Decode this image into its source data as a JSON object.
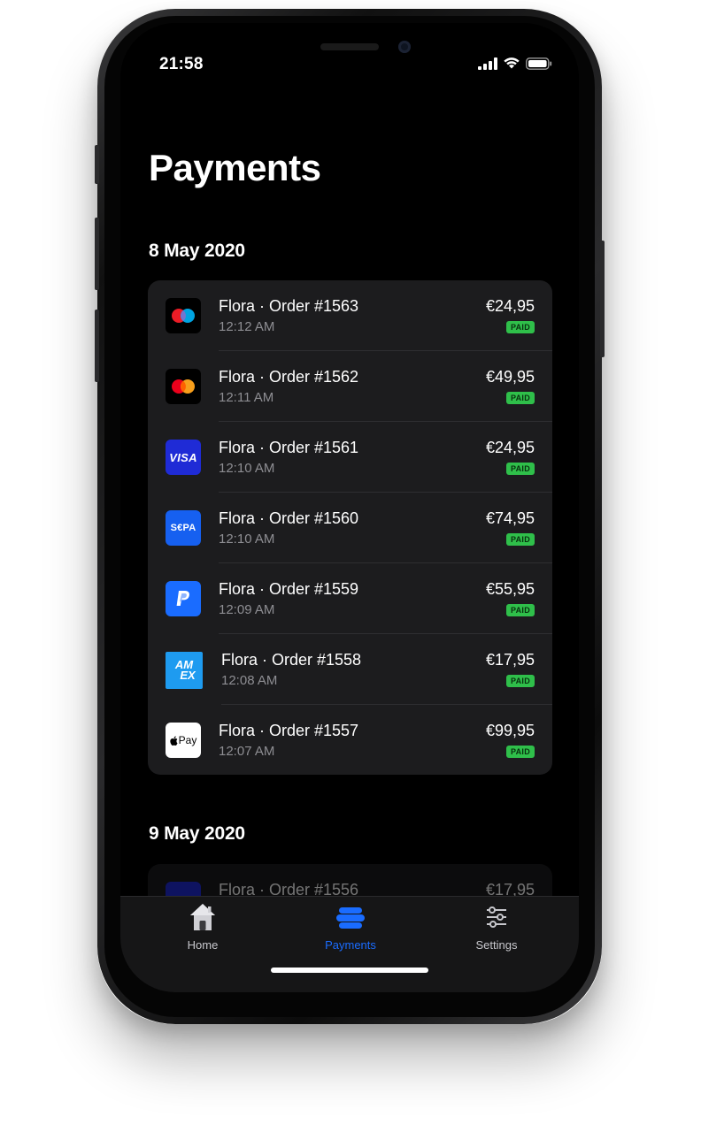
{
  "status_bar": {
    "time": "21:58"
  },
  "page": {
    "title": "Payments"
  },
  "sections": [
    {
      "date": "8 May 2020",
      "payments": [
        {
          "method": "maestro-icon",
          "name": "Flora · Order #1563",
          "time": "12:12 AM",
          "amount": "€24,95",
          "status": "PAID"
        },
        {
          "method": "mastercard-icon",
          "name": "Flora · Order #1562",
          "time": "12:11 AM",
          "amount": "€49,95",
          "status": "PAID"
        },
        {
          "method": "visa-icon",
          "name": "Flora · Order #1561",
          "time": "12:10 AM",
          "amount": "€24,95",
          "status": "PAID"
        },
        {
          "method": "sepa-icon",
          "name": "Flora · Order #1560",
          "time": "12:10 AM",
          "amount": "€74,95",
          "status": "PAID"
        },
        {
          "method": "paypal-icon",
          "name": "Flora · Order #1559",
          "time": "12:09 AM",
          "amount": "€55,95",
          "status": "PAID"
        },
        {
          "method": "amex-icon",
          "name": "Flora · Order #1558",
          "time": "12:08 AM",
          "amount": "€17,95",
          "status": "PAID"
        },
        {
          "method": "apple-pay-icon",
          "name": "Flora · Order #1557",
          "time": "12:07 AM",
          "amount": "€99,95",
          "status": "PAID"
        }
      ]
    },
    {
      "date": "9 May 2020",
      "payments": [
        {
          "method": "visa-icon",
          "name": "Flora · Order #1556",
          "amount": "€17,95"
        }
      ]
    }
  ],
  "icon_labels": {
    "visa": "VISA",
    "sepa": "S€PA",
    "amex_top": "AM",
    "amex_bottom": "EX",
    "apple_pay": "Pay"
  },
  "tabbar": {
    "tabs": [
      {
        "label": "Home",
        "icon": "home-icon"
      },
      {
        "label": "Payments",
        "icon": "payments-icon"
      },
      {
        "label": "Settings",
        "icon": "sliders-icon"
      }
    ],
    "active": "Payments"
  },
  "colors": {
    "background": "#000000",
    "card": "#1c1c1e",
    "accent": "#1a6cff",
    "paid_badge": "#2fbf4a",
    "secondary_text": "#8e8e93",
    "tab_inactive": "#b5b5ba"
  }
}
